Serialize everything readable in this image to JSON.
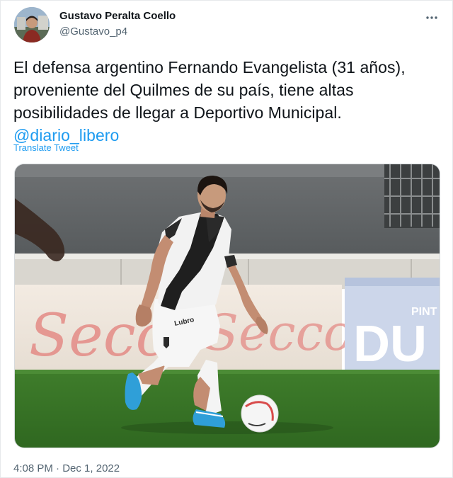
{
  "author": {
    "display_name": "Gustavo Peralta Coello",
    "handle": "@Gustavo_p4"
  },
  "tweet": {
    "text_lines": [
      "El defensa argentino Fernando Evangelista (31 años),",
      "proveniente del Quilmes de su país, tiene altas",
      "posibilidades de llegar a Deportivo Municipal."
    ],
    "mention": "@diario_libero",
    "translate_label": "Translate Tweet",
    "time": "4:08 PM",
    "separator": " · ",
    "date": "Dec 1, 2022"
  },
  "media": {
    "billboard_left_text": "Secco",
    "billboard_right_text_top": "PINT",
    "billboard_right_text_main": "DU",
    "shorts_text": "Lubro"
  },
  "colors": {
    "link": "#1d9bf0",
    "secondary_text": "#536471",
    "primary_text": "#0f1419"
  }
}
